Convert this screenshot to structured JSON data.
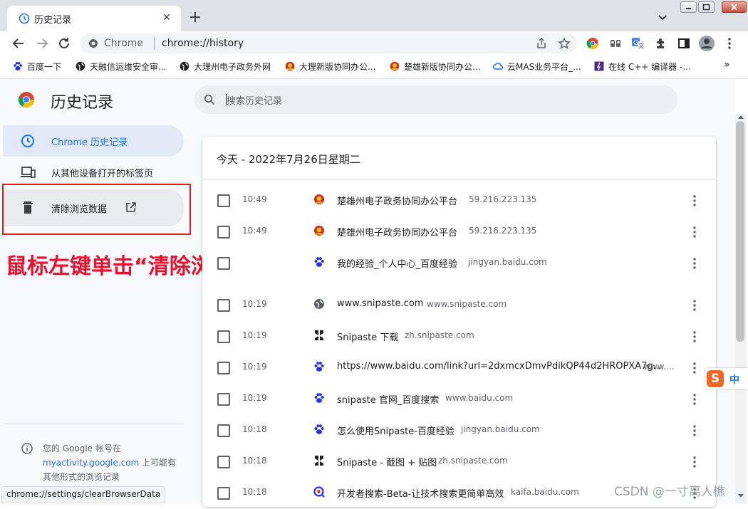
{
  "browser": {
    "tab_title": "历史记录",
    "address_chip": "Chrome",
    "url": "chrome://history"
  },
  "bookmarks": [
    {
      "label": "百度一下",
      "icon": "baidu-paw-icon"
    },
    {
      "label": "天融信运维安全审...",
      "icon": "globe-icon"
    },
    {
      "label": "大理州电子政务外网",
      "icon": "globe-icon"
    },
    {
      "label": "大理新版协同办公...",
      "icon": "emblem-icon"
    },
    {
      "label": "楚雄新版协同办公...",
      "icon": "emblem-icon"
    },
    {
      "label": "云MAS业务平台_...",
      "icon": "cloud-icon"
    },
    {
      "label": "在线 C++ 编译器 -...",
      "icon": "code-icon"
    }
  ],
  "sidebar": {
    "app_title": "历史记录",
    "items": [
      {
        "label": "Chrome 历史记录",
        "icon": "clock-icon"
      },
      {
        "label": "从其他设备打开的标签页",
        "icon": "devices-icon"
      },
      {
        "label": "清除浏览数据",
        "icon": "trash-icon"
      }
    ],
    "footer_prefix": "您的 Google 帐号在",
    "footer_link": "myactivity.google.com",
    "footer_suffix": " 上可能有其他形式的浏览记录"
  },
  "search": {
    "placeholder": "搜索历史记录"
  },
  "annotation": "鼠标左键单击“清除浏览数据”",
  "history": {
    "date_header": "今天 - 2022年7月26日星期二",
    "rows": [
      {
        "time": "10:49",
        "title": "楚雄州电子政务协同办公平台",
        "domain": "59.216.223.135",
        "icon": "emblem-icon"
      },
      {
        "time": "10:49",
        "title": "楚雄州电子政务协同办公平台",
        "domain": "59.216.223.135",
        "icon": "emblem-icon"
      },
      {
        "time": "",
        "title": "我的经验_个人中心_百度经验",
        "domain": "jingyan.baidu.com",
        "icon": "baidu-paw-icon"
      },
      {
        "time": "10:19",
        "title": "www.snipaste.com",
        "domain": "www.snipaste.com",
        "icon": "globe-icon"
      },
      {
        "time": "10:19",
        "title": "Snipaste 下载",
        "domain": "zh.snipaste.com",
        "icon": "snipaste-icon"
      },
      {
        "time": "10:19",
        "title": "https://www.baidu.com/link?url=2dxmcxDmvPdikQP44d2HROPXA7g...",
        "domain": "www....",
        "icon": "baidu-paw-icon"
      },
      {
        "time": "10:19",
        "title": "snipaste 官网_百度搜索",
        "domain": "www.baidu.com",
        "icon": "baidu-paw-icon"
      },
      {
        "time": "10:18",
        "title": "怎么使用Snipaste-百度经验",
        "domain": "jingyan.baidu.com",
        "icon": "baidu-paw-icon"
      },
      {
        "time": "10:18",
        "title": "Snipaste - 截图 + 贴图",
        "domain": "zh.snipaste.com",
        "icon": "snipaste-icon"
      },
      {
        "time": "10:18",
        "title": "开发者搜索-Beta-让技术搜索更简单高效",
        "domain": "kaifa.baidu.com",
        "icon": "kaifa-search-icon"
      }
    ]
  },
  "status_url": "chrome://settings/clearBrowserData",
  "ime": {
    "logo": "S",
    "mode": "中"
  },
  "watermark": "CSDN @一寸离人樵",
  "colors": {
    "accent": "#1a73e8",
    "annotation": "#e8102e",
    "highlight_box": "#e41b1b"
  }
}
